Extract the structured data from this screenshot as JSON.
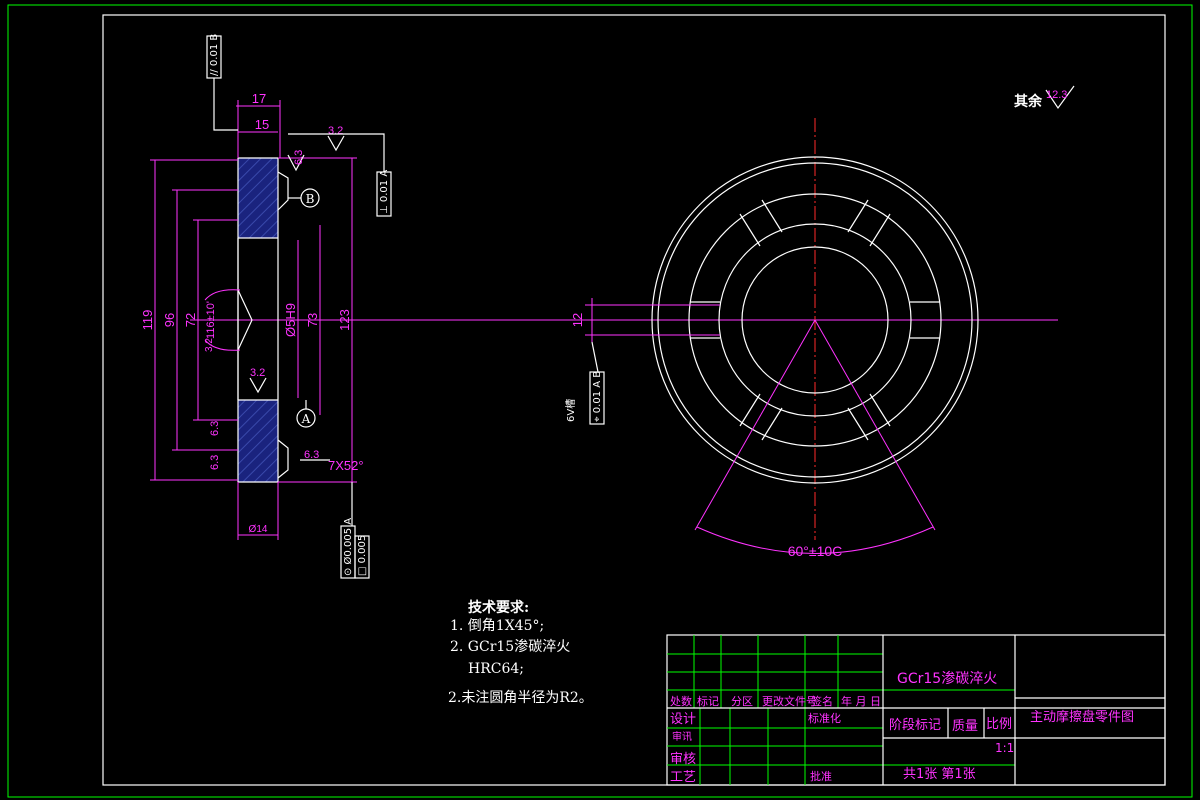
{
  "drawing": {
    "dims_left": {
      "d119": "119",
      "d96": "96",
      "d72": "72",
      "d116": "116±10'",
      "d5H9": "Ø5H9",
      "d73": "73",
      "d123": "123",
      "d17": "17",
      "d15": "15",
      "d14": "Ø14",
      "r63a": "6.3",
      "r63b": "6.3",
      "r63c": "6.3",
      "r63d": "6.3",
      "r32a": "3.2",
      "r32b": "3.2",
      "r32c": "3.2",
      "chamfer": "7X52°"
    },
    "datums": {
      "a": "A",
      "b": "B"
    },
    "tolerances": {
      "top_parallel": "// 0.01 B",
      "right_perp": "⊥ 0.01 A",
      "bottom_runout1": "⊙ Ø0.005 A",
      "bottom_runout2": "□ 0.005",
      "mid_position": "⌖ 0.01 A B"
    },
    "dims_right": {
      "d12": "12",
      "angle": "60°±10C",
      "side_note": "6V槽"
    },
    "surface_default": {
      "label": "其余",
      "value": "12.3"
    }
  },
  "tech_requirements": {
    "title": "技术要求:",
    "line1": "1. 倒角1X45°;",
    "line2": "2. GCr15渗碳淬火",
    "line3": "HRC64;",
    "line4": "2.未注圆角半径为R2。"
  },
  "title_block": {
    "material": "GCr15渗碳淬火",
    "part_name": "主动摩擦盘零件图",
    "row_headers": [
      "处数",
      "标记",
      "分区",
      "更改文件号",
      "签名",
      "年 月 日"
    ],
    "design": "设计",
    "design_sub": "审讯",
    "standard": "标准化",
    "review": "审核",
    "process": "工艺",
    "approve": "批准",
    "stage_mark": "阶段标记",
    "weight": "质量",
    "scale": "比例",
    "scale_value": "1:1",
    "sheets": "共1张 第1张"
  },
  "colors": {
    "line": "#ffffff",
    "dimension": "#ff33ff",
    "frame": "#00ff00",
    "center": "#ff2a2a",
    "hatch": "#2233aa"
  }
}
